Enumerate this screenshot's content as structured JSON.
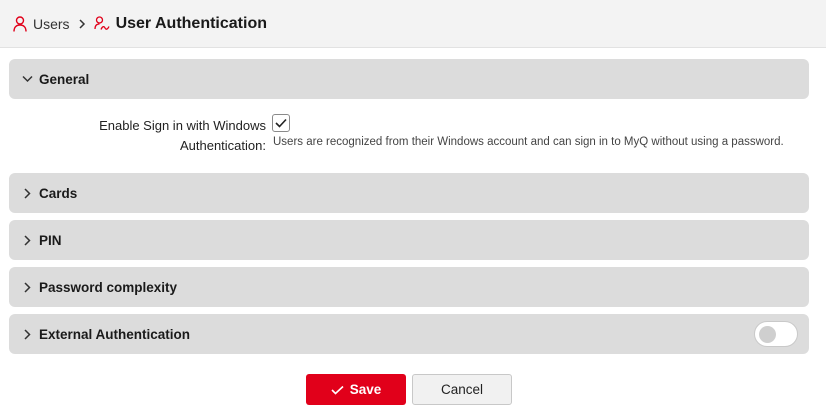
{
  "breadcrumb": {
    "users_label": "Users",
    "title": "User Authentication",
    "users_icon": "user-icon",
    "title_icon": "user-auth-icon",
    "separator_icon": "chevron-right-icon"
  },
  "sections": {
    "general": {
      "label": "General",
      "expanded": true
    },
    "cards": {
      "label": "Cards",
      "expanded": false
    },
    "pin": {
      "label": "PIN",
      "expanded": false
    },
    "password_complexity": {
      "label": "Password complexity",
      "expanded": false
    },
    "external_auth": {
      "label": "External Authentication",
      "expanded": false,
      "toggle_on": false
    }
  },
  "general_settings": {
    "windows_auth": {
      "label_line1": "Enable Sign in with Windows",
      "label_line2": "Authentication:",
      "checked": true,
      "description": "Users are recognized from their Windows account and can sign in to MyQ without using a password."
    }
  },
  "actions": {
    "save_label": "Save",
    "cancel_label": "Cancel"
  },
  "colors": {
    "accent": "#e1001a",
    "header_bg": "#f3f3f3",
    "section_bg": "#dcdcdc"
  }
}
